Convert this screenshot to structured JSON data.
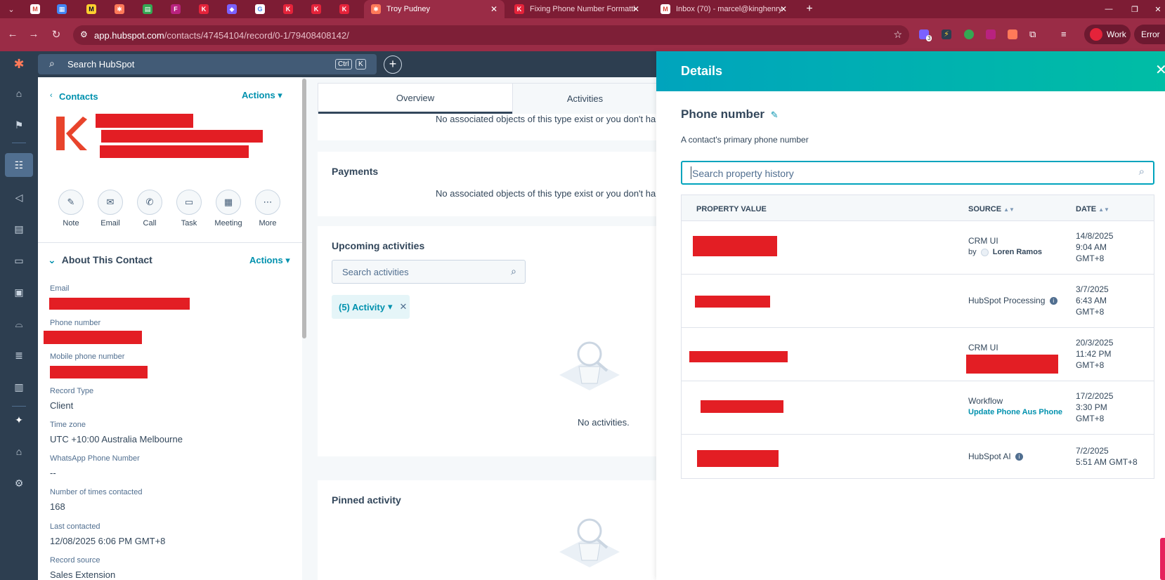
{
  "browser": {
    "tabs": [
      {
        "title": "Troy Pudney"
      },
      {
        "title": "Fixing Phone Number Formatting"
      },
      {
        "title": "Inbox (70) - marcel@kinghenry."
      }
    ],
    "new_tab": "+",
    "url_host": "app.hubspot.com",
    "url_path": "/contacts/47454104/record/0-1/79408408142/",
    "profile": "Work",
    "status": "Error",
    "extension_badge": "3"
  },
  "topbar": {
    "search_placeholder": "Search HubSpot",
    "shortcut_ctrl": "Ctrl",
    "shortcut_k": "K"
  },
  "contact": {
    "breadcrumb": "Contacts",
    "actions": "Actions",
    "action_buttons": [
      "Note",
      "Email",
      "Call",
      "Task",
      "Meeting",
      "More"
    ],
    "section_title": "About This Contact",
    "section_actions": "Actions",
    "properties": [
      {
        "label": "Email",
        "value": ""
      },
      {
        "label": "Phone number",
        "value": ""
      },
      {
        "label": "Mobile phone number",
        "value": ""
      },
      {
        "label": "Record Type",
        "value": "Client"
      },
      {
        "label": "Time zone",
        "value": "UTC +10:00 Australia Melbourne"
      },
      {
        "label": "WhatsApp Phone Number",
        "value": "--"
      },
      {
        "label": "Number of times contacted",
        "value": "168"
      },
      {
        "label": "Last contacted",
        "value": "12/08/2025 6:06 PM GMT+8"
      },
      {
        "label": "Record source",
        "value": "Sales Extension"
      }
    ]
  },
  "middle": {
    "tabs": [
      "Overview",
      "Activities"
    ],
    "no_objects": "No associated objects of this type exist or you don't ha",
    "payments_title": "Payments",
    "upcoming_title": "Upcoming activities",
    "activity_search_placeholder": "Search activities",
    "activity_chip": "(5) Activity",
    "no_activities": "No activities.",
    "pinned_title": "Pinned activity"
  },
  "details": {
    "header": "Details",
    "property_title": "Phone number",
    "property_description": "A contact's primary phone number",
    "search_placeholder": "Search property history",
    "columns": [
      "PROPERTY VALUE",
      "SOURCE",
      "DATE"
    ],
    "rows": [
      {
        "source": "CRM UI",
        "source_by": "by",
        "source_user": "Loren Ramos",
        "date": [
          "14/8/2025",
          "9:04 AM",
          "GMT+8"
        ]
      },
      {
        "source": "HubSpot Processing",
        "date": [
          "3/7/2025",
          "6:43 AM",
          "GMT+8"
        ]
      },
      {
        "source": "CRM UI",
        "date": [
          "20/3/2025",
          "11:42 PM",
          "GMT+8"
        ]
      },
      {
        "source": "Workflow",
        "source_link": "Update Phone Aus Phone",
        "date": [
          "17/2/2025",
          "3:30 PM",
          "GMT+8"
        ]
      },
      {
        "source": "HubSpot AI",
        "date": [
          "7/2/2025",
          "5:51 AM GMT+8"
        ]
      }
    ]
  }
}
